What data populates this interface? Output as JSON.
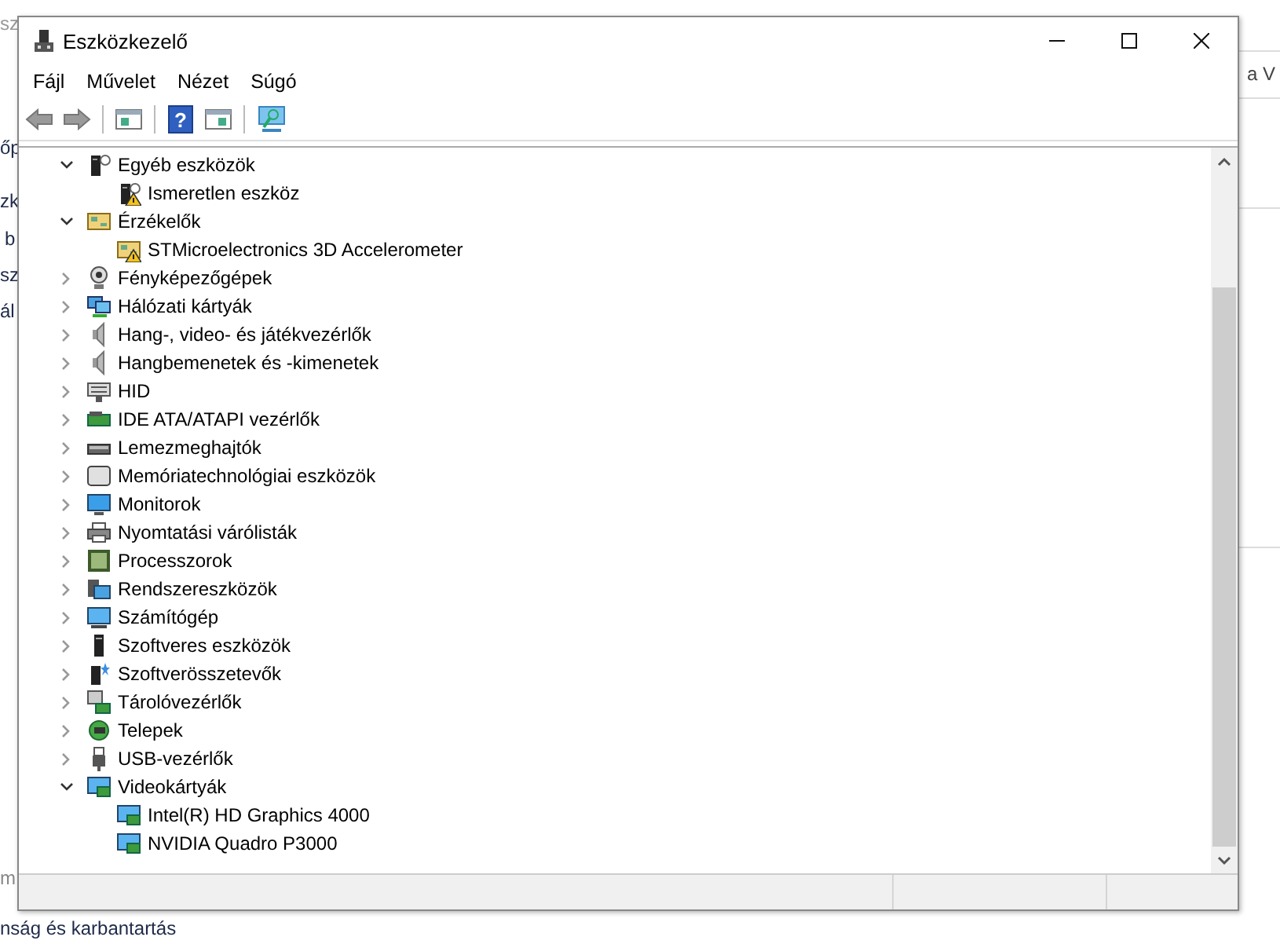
{
  "background_window": {
    "left_fragments": [
      "sz",
      "őp",
      "zk",
      "b",
      "sz",
      "ál",
      "m",
      "nság és karbantartás"
    ],
    "right_fragments": [
      "a V"
    ]
  },
  "window": {
    "title": "Eszközkezelő"
  },
  "menu": [
    "Fájl",
    "Művelet",
    "Nézet",
    "Súgó"
  ],
  "toolbar": {
    "help_glyph": "?"
  },
  "tree": [
    {
      "label": "Egyéb eszközök",
      "expanded": true,
      "children": [
        {
          "label": "Ismeretlen eszköz",
          "warning": true
        }
      ]
    },
    {
      "label": "Érzékelők",
      "expanded": true,
      "children": [
        {
          "label": "STMicroelectronics 3D Accelerometer",
          "warning": true
        }
      ]
    },
    {
      "label": "Fényképezőgépek",
      "expanded": false
    },
    {
      "label": "Hálózati kártyák",
      "expanded": false
    },
    {
      "label": "Hang-, video- és játékvezérlők",
      "expanded": false
    },
    {
      "label": "Hangbemenetek és -kimenetek",
      "expanded": false
    },
    {
      "label": "HID",
      "expanded": false
    },
    {
      "label": "IDE ATA/ATAPI vezérlők",
      "expanded": false
    },
    {
      "label": "Lemezmeghajtók",
      "expanded": false
    },
    {
      "label": "Memóriatechnológiai eszközök",
      "expanded": false
    },
    {
      "label": "Monitorok",
      "expanded": false
    },
    {
      "label": "Nyomtatási várólisták",
      "expanded": false
    },
    {
      "label": "Processzorok",
      "expanded": false
    },
    {
      "label": "Rendszereszközök",
      "expanded": false
    },
    {
      "label": "Számítógép",
      "expanded": false
    },
    {
      "label": "Szoftveres eszközök",
      "expanded": false
    },
    {
      "label": "Szoftverösszetevők",
      "expanded": false
    },
    {
      "label": "Tárolóvezérlők",
      "expanded": false
    },
    {
      "label": "Telepek",
      "expanded": false
    },
    {
      "label": "USB-vezérlők",
      "expanded": false
    },
    {
      "label": "Videokártyák",
      "expanded": true,
      "children": [
        {
          "label": "Intel(R) HD Graphics 4000",
          "warning": false
        },
        {
          "label": "NVIDIA Quadro P3000",
          "warning": false
        }
      ]
    }
  ]
}
